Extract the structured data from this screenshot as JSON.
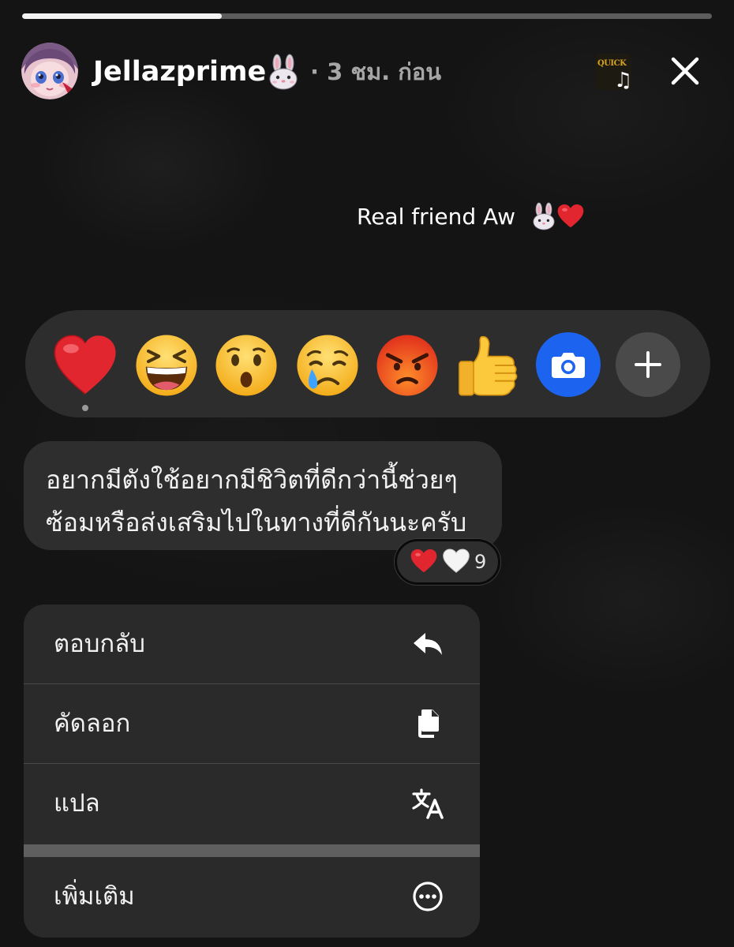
{
  "story": {
    "progress_fraction": 0.29
  },
  "header": {
    "username": "Jellazprime",
    "username_emoji": "rabbit-face",
    "time_ago": "· 3 ชม. ก่อน",
    "music_icon": "music-note-icon",
    "close_icon": "close-icon"
  },
  "caption": {
    "text": "Real friend Aw",
    "emojis": [
      "rabbit-face",
      "red-heart"
    ]
  },
  "reactions": {
    "items": [
      {
        "name": "red-heart",
        "selected": true
      },
      {
        "name": "grinning-squinting-face",
        "selected": false
      },
      {
        "name": "hushed-face",
        "selected": false
      },
      {
        "name": "crying-face",
        "selected": false
      },
      {
        "name": "angry-face",
        "selected": false
      },
      {
        "name": "thumbs-up",
        "selected": false
      }
    ],
    "camera_icon": "camera-icon",
    "add_icon": "plus-icon",
    "colors": {
      "camera": "#1c63ef",
      "add": "#4a4a4a"
    }
  },
  "message": {
    "line1": "อยากมีตังใช้อยากมีชิวิตที่ดีกว่านี้ช่วยๆ",
    "line2": "ซ้อมหรือส่งเสริมไปในทางที่ดีกันนะครับ",
    "reactions": [
      "red-heart",
      "white-heart"
    ],
    "reaction_count": "9"
  },
  "context_menu": {
    "items": [
      {
        "label": "ตอบกลับ",
        "icon": "reply-icon"
      },
      {
        "label": "คัดลอก",
        "icon": "copy-icon"
      },
      {
        "label": "แปล",
        "icon": "translate-icon"
      },
      {
        "label": "เพิ่มเติม",
        "icon": "more-icon"
      }
    ]
  }
}
